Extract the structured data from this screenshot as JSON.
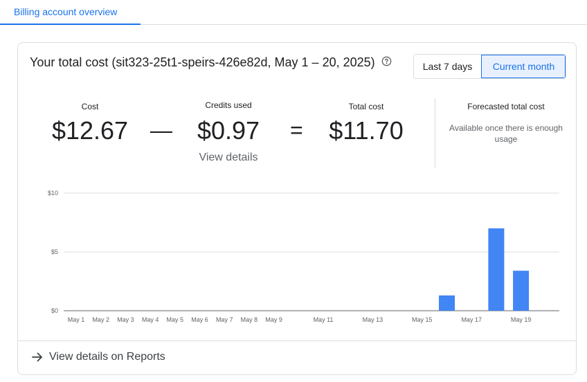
{
  "tabs": {
    "active_label": "Billing account overview"
  },
  "card": {
    "title": "Your total cost (sit323-25t1-speirs-426e82d, May 1 – 20, 2025)",
    "help_icon": "help-circle-icon",
    "range_toggle": {
      "option_1": "Last 7 days",
      "option_2": "Current month",
      "selected": "Current month"
    }
  },
  "summary": {
    "cost_label": "Cost",
    "cost_value": "$12.67",
    "minus": "—",
    "credits_label": "Credits used",
    "credits_value": "$0.97",
    "equals": "=",
    "total_label": "Total cost",
    "total_value": "$11.70",
    "view_details": "View details"
  },
  "forecast": {
    "title": "Forecasted total cost",
    "note": "Available once there is enough usage"
  },
  "chart_data": {
    "type": "bar",
    "x_tick_labels": [
      "May 1",
      "May 2",
      "May 3",
      "May 4",
      "May 5",
      "May 6",
      "May 7",
      "May 8",
      "May 9",
      "May 11",
      "May 13",
      "May 15",
      "May 17",
      "May 19"
    ],
    "y_tick_labels": [
      "$10",
      "$5",
      "$0"
    ],
    "ylim": [
      0,
      10
    ],
    "grid": true,
    "bar_color": "#4285f4",
    "bars": [
      {
        "x": "May 16",
        "value": 1.3
      },
      {
        "x": "May 18",
        "value": 7.0
      },
      {
        "x": "May 19",
        "value": 3.4
      }
    ]
  },
  "footer": {
    "link_label": "View details on Reports",
    "link_icon": "arrow-right-icon"
  }
}
